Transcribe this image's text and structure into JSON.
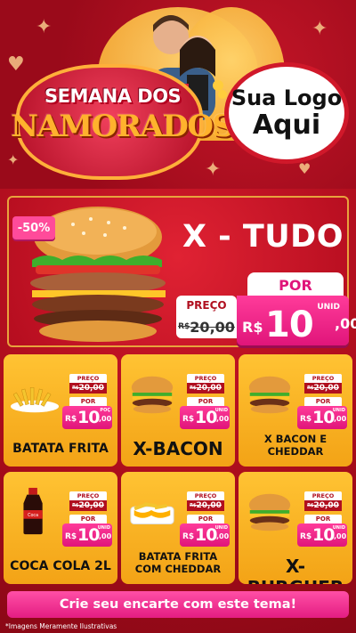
{
  "header": {
    "title_line1": "SEMANA DOS",
    "title_line2": "NAMORADOS",
    "logo_line1": "Sua Logo",
    "logo_line2": "Aqui"
  },
  "hero": {
    "discount": "-50%",
    "name": "X - TUDO",
    "preco_label": "PREÇO",
    "old_currency": "R$",
    "old_value": "20,00",
    "por_label": "POR",
    "unit": "UNID",
    "currency": "R$",
    "price_main": "10",
    "price_cents": ",00"
  },
  "products": [
    {
      "name_l1": "BATATA FRITA",
      "name_l2": "",
      "preco_label": "PREÇO",
      "old_currency": "R$",
      "old_value": "20,00",
      "por_label": "POR",
      "unit": "POÇ",
      "currency": "R$",
      "price_main": "10",
      "price_cents": ",00",
      "icon": "fries-icon"
    },
    {
      "name_l1": "X-BACON",
      "name_l2": "",
      "preco_label": "PREÇO",
      "old_currency": "R$",
      "old_value": "20,00",
      "por_label": "POR",
      "unit": "UNID",
      "currency": "R$",
      "price_main": "10",
      "price_cents": ",00",
      "icon": "burger-icon"
    },
    {
      "name_l1": "X BACON E",
      "name_l2": "CHEDDAR",
      "preco_label": "PREÇO",
      "old_currency": "R$",
      "old_value": "20,00",
      "por_label": "POR",
      "unit": "UNID",
      "currency": "R$",
      "price_main": "10",
      "price_cents": ",00",
      "icon": "burger-icon"
    },
    {
      "name_l1": "COCA COLA 2L",
      "name_l2": "",
      "preco_label": "PREÇO",
      "old_currency": "R$",
      "old_value": "20,00",
      "por_label": "POR",
      "unit": "UNID",
      "currency": "R$",
      "price_main": "10",
      "price_cents": ",00",
      "icon": "soda-bottle-icon"
    },
    {
      "name_l1": "BATATA FRITA",
      "name_l2": "COM CHEDDAR",
      "preco_label": "PREÇO",
      "old_currency": "R$",
      "old_value": "20,00",
      "por_label": "POR",
      "unit": "UNID",
      "currency": "R$",
      "price_main": "10",
      "price_cents": ",00",
      "icon": "cheese-fries-icon"
    },
    {
      "name_l1": "X-BURGUER",
      "name_l2": "",
      "preco_label": "PREÇO",
      "old_currency": "R$",
      "old_value": "20,00",
      "por_label": "POR",
      "unit": "UNID",
      "currency": "R$",
      "price_main": "10",
      "price_cents": ",00",
      "icon": "burger-icon"
    }
  ],
  "footer": {
    "cta": "Crie seu encarte com este tema!",
    "disclaimer": "*Imagens Meramente Ilustrativas"
  },
  "colors": {
    "background_red": "#b10f1f",
    "card_yellow": "#ffc333",
    "price_pink": "#e0157a",
    "title_gold": "#ffb22d"
  }
}
